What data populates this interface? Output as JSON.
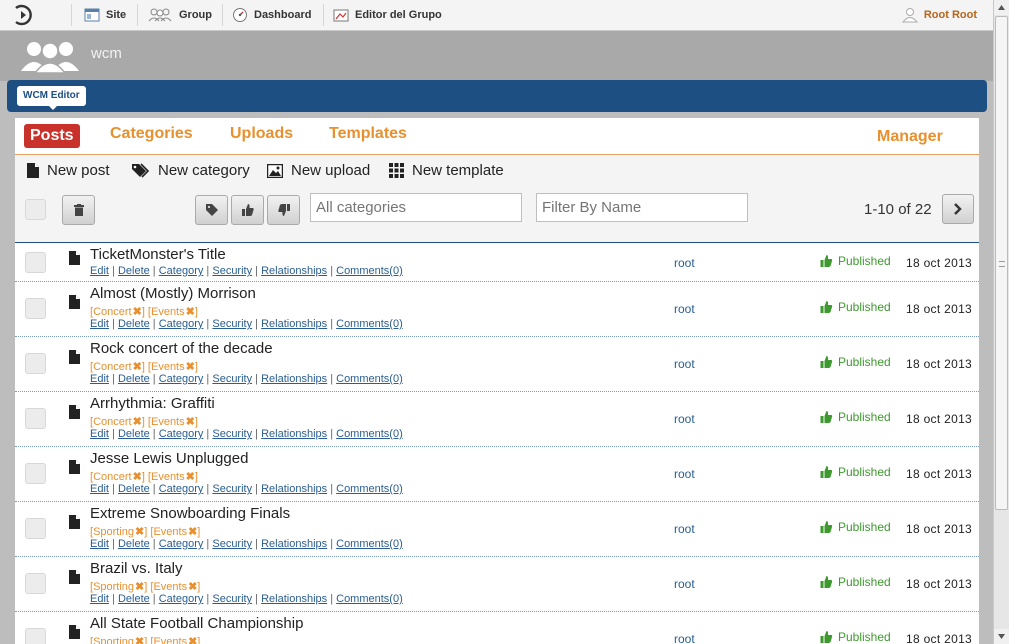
{
  "topbar": {
    "nav": [
      {
        "label": "Site",
        "icon": "site-icon"
      },
      {
        "label": "Group",
        "icon": "group-icon"
      },
      {
        "label": "Dashboard",
        "icon": "dashboard-icon"
      },
      {
        "label": "Editor del Grupo",
        "icon": "editor-icon"
      }
    ],
    "user": "Root Root"
  },
  "header": {
    "site_name": "wcm"
  },
  "portlet": {
    "title": "WCM Editor"
  },
  "tabs": {
    "posts": "Posts",
    "categories": "Categories",
    "uploads": "Uploads",
    "templates": "Templates",
    "manager": "Manager"
  },
  "actions": {
    "new_post": "New post",
    "new_category": "New category",
    "new_upload": "New upload",
    "new_template": "New template"
  },
  "filters": {
    "category_placeholder": "All categories",
    "name_placeholder": "Filter By Name"
  },
  "pager": {
    "text": "1-10 of 22"
  },
  "colors": {
    "accent": "#e8902e",
    "active_tab": "#c9322a",
    "bar": "#1d4f83",
    "published": "#3e9a2e"
  },
  "row_links": [
    "Edit",
    "Delete",
    "Category",
    "Security",
    "Relationships",
    "Comments(0)"
  ],
  "posts": [
    {
      "title": "TicketMonster's Title",
      "categories": [],
      "author": "root",
      "status": "Published",
      "date": "18 oct 2013"
    },
    {
      "title": "Almost (Mostly) Morrison",
      "categories": [
        "Concert",
        "Events"
      ],
      "author": "root",
      "status": "Published",
      "date": "18 oct 2013"
    },
    {
      "title": "Rock concert of the decade",
      "categories": [
        "Concert",
        "Events"
      ],
      "author": "root",
      "status": "Published",
      "date": "18 oct 2013"
    },
    {
      "title": "Arrhythmia: Graffiti",
      "categories": [
        "Concert",
        "Events"
      ],
      "author": "root",
      "status": "Published",
      "date": "18 oct 2013"
    },
    {
      "title": "Jesse Lewis Unplugged",
      "categories": [
        "Concert",
        "Events"
      ],
      "author": "root",
      "status": "Published",
      "date": "18 oct 2013"
    },
    {
      "title": "Extreme Snowboarding Finals",
      "categories": [
        "Sporting",
        "Events"
      ],
      "author": "root",
      "status": "Published",
      "date": "18 oct 2013"
    },
    {
      "title": "Brazil vs. Italy",
      "categories": [
        "Sporting",
        "Events"
      ],
      "author": "root",
      "status": "Published",
      "date": "18 oct 2013"
    },
    {
      "title": "All State Football Championship",
      "categories": [
        "Sporting",
        "Events"
      ],
      "author": "root",
      "status": "Published",
      "date": "18 oct 2013"
    }
  ]
}
